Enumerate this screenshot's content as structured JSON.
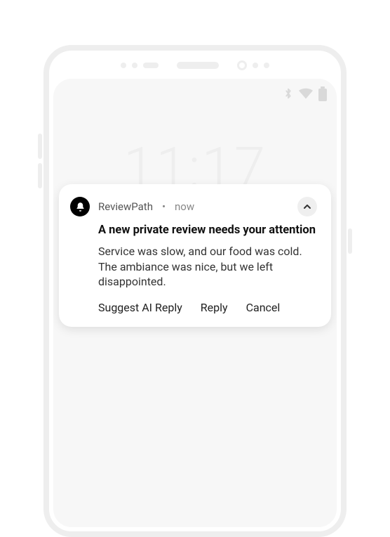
{
  "lockscreen": {
    "time": "11:17"
  },
  "status": {
    "bluetooth_icon": "bluetooth",
    "wifi_icon": "wifi",
    "battery_icon": "battery"
  },
  "notification": {
    "app_name": "ReviewPath",
    "separator": "•",
    "timestamp": "now",
    "title": "A new private review needs your attention",
    "body": "Service was slow, and our food was cold. The ambiance was nice, but we left disappointed.",
    "actions": {
      "suggest": "Suggest AI Reply",
      "reply": "Reply",
      "cancel": "Cancel"
    }
  }
}
